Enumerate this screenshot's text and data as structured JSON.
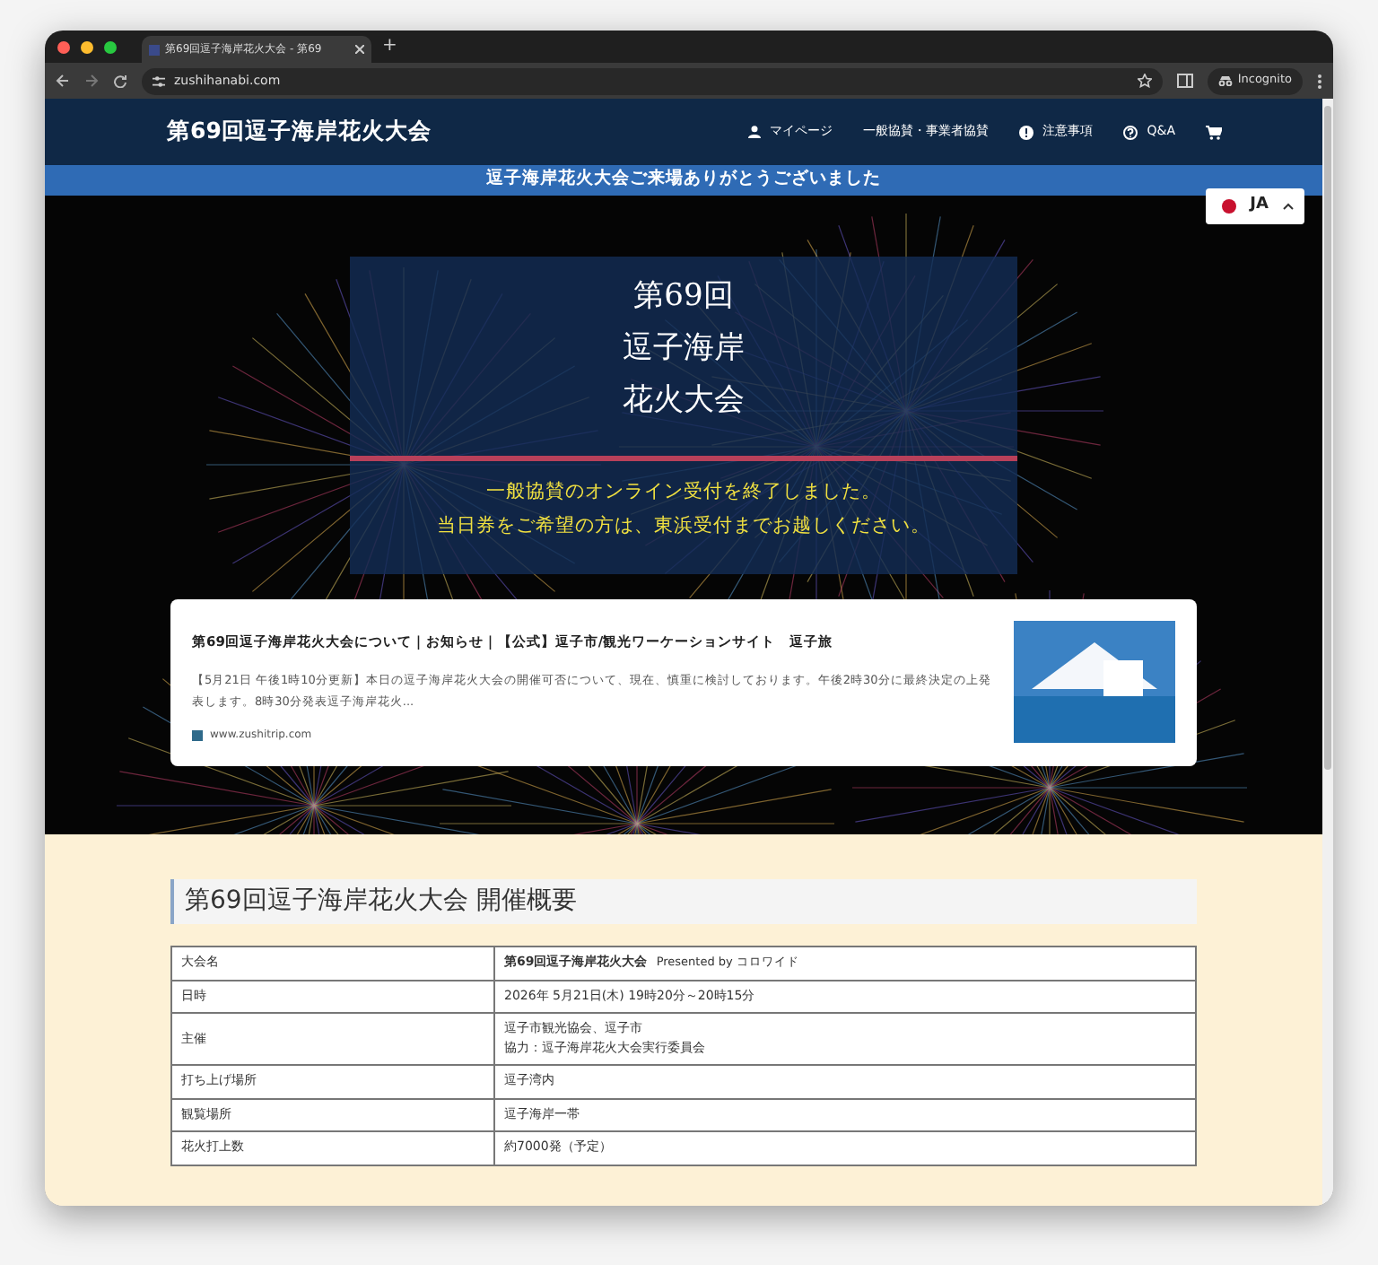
{
  "browser": {
    "tab_title": "第69回逗子海岸花火大会 - 第69",
    "new_tab": "+",
    "url": "zushihanabi.com",
    "incognito": "Incognito"
  },
  "navbar": {
    "brand": "第69回逗子海岸花火大会",
    "links": [
      {
        "kind": "user",
        "label": "マイページ"
      },
      {
        "kind": "plain",
        "label": "一般協賛・事業者協賛"
      },
      {
        "kind": "notice",
        "label": "注意事項"
      },
      {
        "kind": "help",
        "label": "Q&A"
      },
      {
        "kind": "cart"
      }
    ]
  },
  "banner": "逗子海岸花火大会ご来場ありがとうございました",
  "language": {
    "label": "JA"
  },
  "hero": {
    "title_lines": [
      "第69回",
      "逗子海岸",
      "花火大会"
    ],
    "notice_lines": [
      "一般協賛のオンライン受付を終了しました。",
      "当日券をご希望の方は、東浜受付までお越しください。"
    ]
  },
  "link_card": {
    "title": "第69回逗子海岸花火大会について｜お知らせ｜【公式】逗子市/観光ワーケーションサイト　逗子旅",
    "description": "【5月21日 午後1時10分更新】本日の逗子海岸花火大会の開催可否について、現在、慎重に検討しております。午後2時30分に最終決定の上発表します。8時30分発表逗子海岸花火...",
    "domain": "www.zushitrip.com"
  },
  "overview": {
    "heading": "第69回逗子海岸花火大会 開催概要",
    "rows": [
      {
        "label": "大会名",
        "value_lines": [
          "第69回逗子海岸花火大会"
        ],
        "note": "Presented by コロワイド"
      },
      {
        "label": "日時",
        "value_lines": [
          "2026年 5月21日(木) 19時20分～20時15分"
        ]
      },
      {
        "label": "主催",
        "value_lines": [
          "逗子市観光協会、逗子市",
          "協力：逗子海岸花火大会実行委員会"
        ]
      },
      {
        "label": "打ち上げ場所",
        "value_lines": [
          "逗子湾内"
        ]
      },
      {
        "label": "観覧場所",
        "value_lines": [
          "逗子海岸一帯"
        ]
      },
      {
        "label": "花火打上数",
        "value_lines": [
          "約7000発（予定）"
        ]
      }
    ]
  }
}
